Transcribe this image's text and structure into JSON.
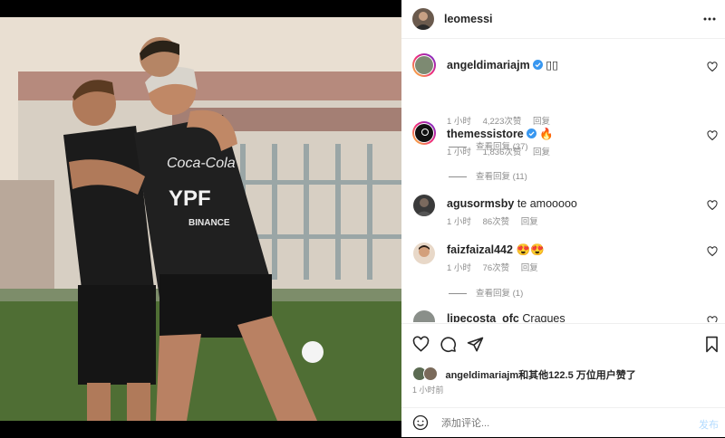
{
  "post": {
    "author": "leomessi",
    "more_icon": "more-horizontal-icon",
    "photo_jersey_sponsor": "YPF",
    "photo_jersey_brand": "Coca-Cola",
    "photo_sleeve_text": "BINANCE"
  },
  "comments": [
    {
      "username": "angeldimariajm",
      "verified": true,
      "text": "▯▯",
      "time": "1 小时",
      "likes": "4,223次赞",
      "reply": "回复",
      "view_replies": "查看回复 (37)"
    },
    {
      "username": "themessistore",
      "verified": true,
      "text": "🔥",
      "time": "1 小时",
      "likes": "1,836次赞",
      "reply": "回复",
      "view_replies": "查看回复 (11)"
    },
    {
      "username": "agusormsby",
      "verified": false,
      "text": "te amooooo",
      "time": "1 小时",
      "likes": "86次赞",
      "reply": "回复",
      "view_replies": ""
    },
    {
      "username": "faizfaizal442",
      "verified": false,
      "text": "😍😍",
      "time": "1 小时",
      "likes": "76次赞",
      "reply": "回复",
      "view_replies": "查看回复 (1)"
    },
    {
      "username": "lipecosta_ofc",
      "verified": false,
      "text": "Craques",
      "time": "",
      "likes": "",
      "reply": "",
      "view_replies": ""
    }
  ],
  "likes_summary": {
    "user": "angeldimariajm",
    "text": "和其他122.5 万位用户赞了"
  },
  "post_time": "1 小时前",
  "add_comment": {
    "placeholder": "添加评论...",
    "post_label": "发布"
  },
  "colors": {
    "verified": "#3897f0",
    "post_button": "#b3dbff",
    "meta_gray": "#8e8e8e"
  }
}
